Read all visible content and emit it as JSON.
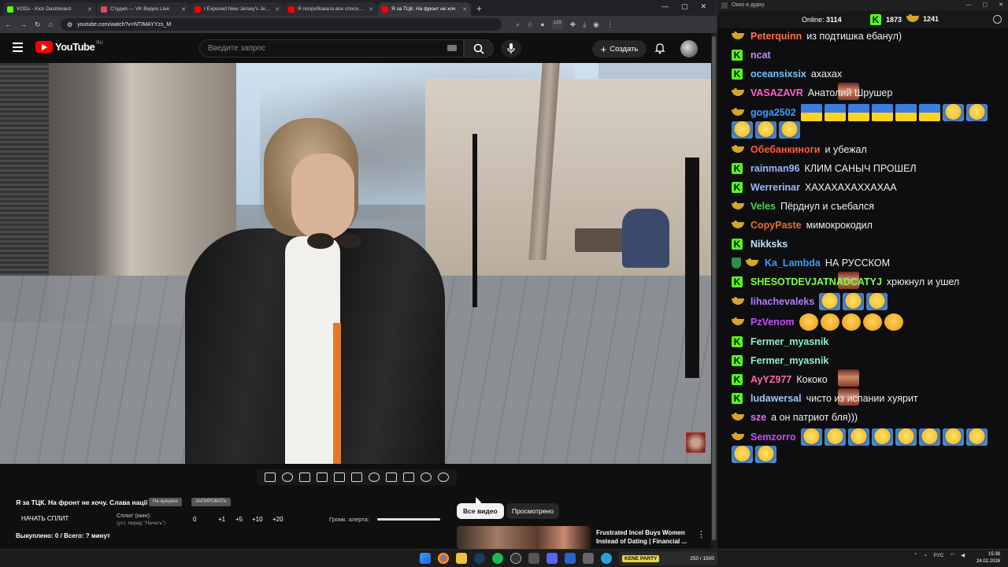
{
  "browser": {
    "tabs": [
      {
        "title": "VODs - Kick Dashboard",
        "color": "#53fc18"
      },
      {
        "title": "Студия — VK Видео Live",
        "color": "#e04a5f"
      },
      {
        "title": "I Exposed New Jersey's Jewish",
        "color": "#ff0000"
      },
      {
        "title": "Я попробовала все способы б",
        "color": "#ff0000"
      },
      {
        "title": "Я за ТЦК. На фронт не хоч",
        "color": "#ff0000"
      }
    ],
    "url": "youtube.com/watch?v=NTIMAYYzs_M",
    "ext_badge": "129"
  },
  "youtube": {
    "logo_text": "YouTube",
    "region": "RU",
    "search_placeholder": "Введите запрос",
    "create_label": "Создать"
  },
  "split_panel": {
    "video_title": "Я за ТЦК. На фронт не хочу. Слава нації",
    "chip1": "На аукцион",
    "chip2": "ЗАПИРОВАТЬ",
    "start_split": "НАЧАТЬ СПЛИТ",
    "split_label": "Сплит (мин):",
    "split_sub": "(уст. перед \"Начать\")",
    "values": [
      "0",
      "+1",
      "+5",
      "+10",
      "+20"
    ],
    "alert_label": "Громк. алерта:",
    "bought": "Выкуплено: 0 / Всего: ? минут"
  },
  "recommend": {
    "chip_all": "Все видео",
    "chip_watched": "Просмотрено",
    "title": "Frustrated Incel Buys Women Instead of Dating | Financial ..."
  },
  "chat": {
    "window_title": "Окно в дурку",
    "online_label": "Online:",
    "online": "3114",
    "kick_count": "1873",
    "yt_count": "1241",
    "messages": [
      {
        "badge": "y",
        "user": "Peterquinn",
        "color": "#ff6e4a",
        "text": "из подтишка ебанул)",
        "emotes": []
      },
      {
        "badge": "k",
        "user": "ncat",
        "color": "#c58aff",
        "text": "",
        "emotes": [
          "face"
        ]
      },
      {
        "badge": "k",
        "user": "oceansixsix",
        "color": "#6ec6ff",
        "text": "ахахах",
        "emotes": []
      },
      {
        "badge": "y",
        "user": "VASAZAVR",
        "color": "#ff5ec8",
        "text": "Анатолий Шрушер",
        "emotes": []
      },
      {
        "badge": "y",
        "user": "goga2502",
        "color": "#3b9cff",
        "text": "",
        "emotes": [
          "ua",
          "ua",
          "ua",
          "ua",
          "ua",
          "ua",
          "lol",
          "lol",
          "lol",
          "lol",
          "lol"
        ]
      },
      {
        "badge": "y",
        "user": "Обебанкиноги",
        "color": "#ff5a3c",
        "text": "и убежал",
        "emotes": []
      },
      {
        "badge": "k",
        "user": "rainman96",
        "color": "#9ab8ff",
        "text": "КЛИМ САНЫЧ ПРОШЕЛ",
        "emotes": []
      },
      {
        "badge": "k",
        "user": "Werrerinar",
        "color": "#9ab8ff",
        "text": "ХАХАХАХАХХАХАА",
        "emotes": []
      },
      {
        "badge": "y",
        "user": "Veles",
        "color": "#4fd14f",
        "text": "Пёрднул и съебался",
        "emotes": []
      },
      {
        "badge": "y",
        "user": "CopyPaste",
        "color": "#e0702e",
        "text": "мимокрокодил",
        "emotes": []
      },
      {
        "badge": "k",
        "user": "Nikksks",
        "color": "#bfe0ff",
        "text": "",
        "emotes": [
          "face",
          "face",
          "face"
        ]
      },
      {
        "badge": "sy",
        "user": "Ka_Lambda",
        "color": "#3b9cff",
        "text": "НА РУССКОМ",
        "emotes": []
      },
      {
        "badge": "k",
        "user": "SHESOTDEVJATNADCATYJ",
        "color": "#7fff4a",
        "text": "хрюкнул и ушел",
        "emotes": []
      },
      {
        "badge": "y",
        "user": "lihachevaleks",
        "color": "#b57cff",
        "text": "",
        "emotes": [
          "lol",
          "lol",
          "lol"
        ]
      },
      {
        "badge": "y",
        "user": "PzVenom",
        "color": "#c54dff",
        "text": "",
        "emotes": [
          "cry",
          "cry",
          "cry",
          "cry",
          "cry"
        ]
      },
      {
        "badge": "k",
        "user": "Fermer_myasnik",
        "color": "#8ff0c8",
        "text": "",
        "emotes": [
          "face"
        ]
      },
      {
        "badge": "k",
        "user": "Fermer_myasnik",
        "color": "#8ff0c8",
        "text": "",
        "emotes": [
          "face"
        ]
      },
      {
        "badge": "k",
        "user": "AyYZ977",
        "color": "#ff6aa8",
        "text": "Кококо",
        "emotes": []
      },
      {
        "badge": "k",
        "user": "ludawersal",
        "color": "#a0c4ff",
        "text": "чисто из испании хуярит",
        "emotes": []
      },
      {
        "badge": "y",
        "user": "sze",
        "color": "#e56cff",
        "text": "а он патриот бля)))",
        "emotes": []
      },
      {
        "badge": "y",
        "user": "Semzorro",
        "color": "#c54dff",
        "text": "",
        "emotes": [
          "lol",
          "lol",
          "lol",
          "lol",
          "lol",
          "lol",
          "lol",
          "lol",
          "lol",
          "lol"
        ]
      }
    ]
  },
  "taskbar": {
    "kick_badge": "KENE PARTY",
    "kick_stat": "250 / 1500",
    "lang": "РУС",
    "time": "15:38",
    "date": "24.02.2026"
  }
}
